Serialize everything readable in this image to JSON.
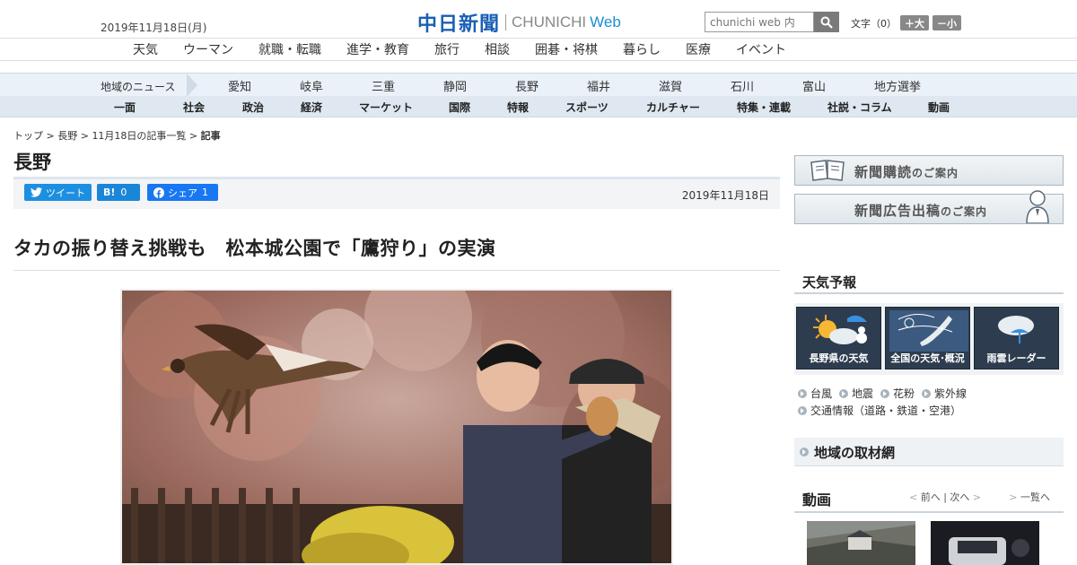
{
  "header": {
    "date": "2019年11月18日(月)",
    "logo_jp": "中日新聞",
    "logo_en": "CHUNICHI",
    "logo_web": "Web",
    "search_placeholder": "chunichi web 内",
    "font_label": "文字（0）",
    "font_bigger": "＋大",
    "font_smaller": "－小"
  },
  "nav_main": [
    "天気",
    "ウーマン",
    "就職・転職",
    "進学・教育",
    "旅行",
    "相談",
    "囲碁・将棋",
    "暮らし",
    "医療",
    "イベント"
  ],
  "nav_region": {
    "label": "地域のニュース",
    "items": [
      "愛知",
      "岐阜",
      "三重",
      "静岡",
      "長野",
      "福井",
      "滋賀",
      "石川",
      "富山",
      "地方選挙"
    ]
  },
  "nav_category": [
    "一面",
    "社会",
    "政治",
    "経済",
    "マーケット",
    "国際",
    "特報",
    "スポーツ",
    "カルチャー",
    "特集・連載",
    "社説・コラム",
    "動画"
  ],
  "breadcrumb": {
    "items": [
      "トップ",
      "長野",
      "11月18日の記事一覧"
    ],
    "current": "記事",
    "sep": " > "
  },
  "section_title": "長野",
  "share": {
    "tweet": "ツイート",
    "hatena": "B!",
    "hatena_count": "0",
    "facebook": "シェア",
    "facebook_count": "1"
  },
  "article": {
    "date": "2019年11月18日",
    "headline": "タカの振り替え挑戦も　松本城公園で「鷹狩り」の実演"
  },
  "sidebar": {
    "banner_subscribe": "新聞購読",
    "banner_subscribe_sub": "のご案内",
    "banner_ad": "新聞広告出稿",
    "banner_ad_sub": "のご案内",
    "weather_title": "天気予報",
    "weather_tiles": [
      "長野県の天気",
      "全国の天気･概況",
      "雨雲レーダー"
    ],
    "weather_links": [
      "台風",
      "地震",
      "花粉",
      "紫外線"
    ],
    "traffic_link": "交通情報（道路・鉄道・空港）",
    "region_title": "地域の取材網",
    "video_title": "動画",
    "video_prev": "前へ",
    "video_next": "次へ",
    "video_sep": " | ",
    "video_all": "一覧へ"
  },
  "colors": {
    "brand_blue": "#1a5fb4",
    "web_blue": "#1a8fd0",
    "twitter": "#1d8fe0",
    "facebook": "#1877f2"
  }
}
